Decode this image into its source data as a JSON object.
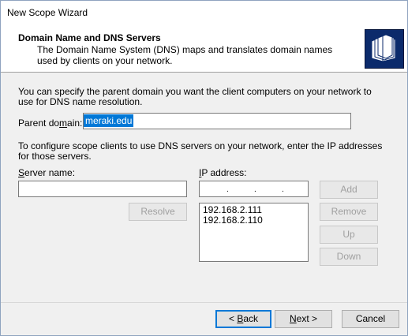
{
  "window": {
    "title": "New Scope Wizard"
  },
  "header": {
    "title": "Domain Name and DNS Servers",
    "description": "The Domain Name System (DNS) maps and translates domain names used by clients on your network.",
    "icon": "wizard-pages-icon"
  },
  "parent_domain": {
    "intro": "You can specify the parent domain you want the client computers on your network to use for DNS name resolution.",
    "label_pre": "Parent do",
    "label_accel": "m",
    "label_post": "ain:",
    "value": "meraki.edu"
  },
  "dns": {
    "intro": "To configure scope clients to use DNS servers on your network, enter the IP addresses for those servers.",
    "server_label_pre": "",
    "server_label_accel": "S",
    "server_label_post": "erver name:",
    "server_value": "",
    "ip_label_pre": "",
    "ip_label_accel": "I",
    "ip_label_post": "P address:",
    "ip_dot": ".",
    "servers": [
      "192.168.2.111",
      "192.168.2.110"
    ]
  },
  "buttons": {
    "resolve": "Resolve",
    "add": "Add",
    "remove": "Remove",
    "up": "Up",
    "down": "Down"
  },
  "footer": {
    "back_pre": "< ",
    "back_accel": "B",
    "back_post": "ack",
    "next_pre": "",
    "next_accel": "N",
    "next_post": "ext >",
    "cancel": "Cancel"
  }
}
